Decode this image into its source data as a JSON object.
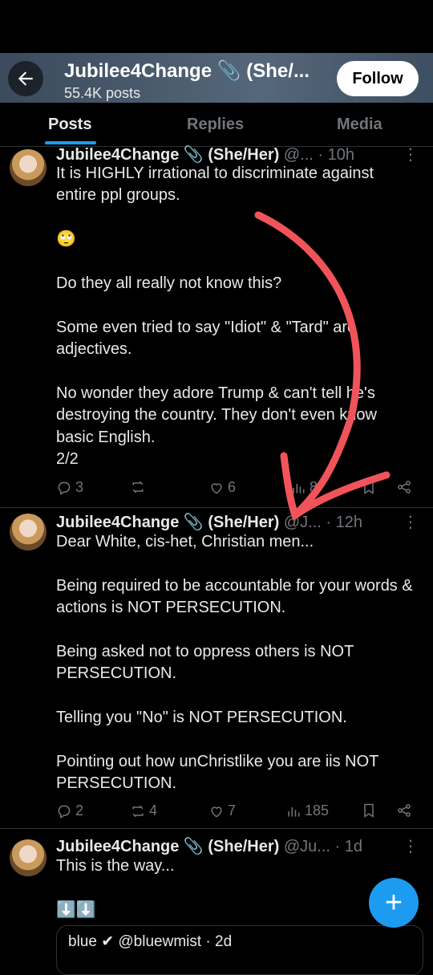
{
  "header": {
    "title": "Jubilee4Change 📎 (She/...",
    "subtitle": "55.4K posts",
    "follow_label": "Follow",
    "back_icon": "back-arrow-icon"
  },
  "tabs": [
    {
      "label": "Posts"
    },
    {
      "label": "Replies"
    },
    {
      "label": "Media"
    }
  ],
  "posts": [
    {
      "header": "Jubilee4Change 📎 (She/Her) @... · 10h",
      "name": "Jubilee4Change 📎 (She/Her)",
      "meta": " @... · 10h",
      "text": "It is HIGHLY irrational to discriminate against entire ppl groups.\n\n🙄\n\nDo they all really not know this?\n\nSome even tried to say \"Idiot\" & \"Tard\" are adjectives.\n\nNo wonder they adore Trump & can't tell he's destroying the country. They don't even know basic English.\n2/2",
      "replies": "3",
      "reposts": "",
      "likes": "6",
      "views": "8"
    },
    {
      "name": "Jubilee4Change 📎 (She/Her)",
      "meta": " @J... · 12h",
      "text": "Dear White, cis-het, Christian men...\n\nBeing required to be accountable for your words & actions is NOT PERSECUTION.\n\nBeing asked not to oppress others is NOT PERSECUTION.\n\nTelling you \"No\" is NOT PERSECUTION.\n\nPointing out how unChristlike you are iis NOT PERSECUTION.",
      "replies": "2",
      "reposts": "4",
      "likes": "7",
      "views": "185"
    },
    {
      "name": "Jubilee4Change 📎 (She/Her)",
      "meta": " @Ju... · 1d",
      "text": "This is the way...\n\n⬇️⬇️",
      "quote_text": "blue ✔ @bluewmist · 2d"
    }
  ],
  "fab_label": "+",
  "colors": {
    "accent": "#1d9bf0",
    "annotation": "#f0545a"
  }
}
